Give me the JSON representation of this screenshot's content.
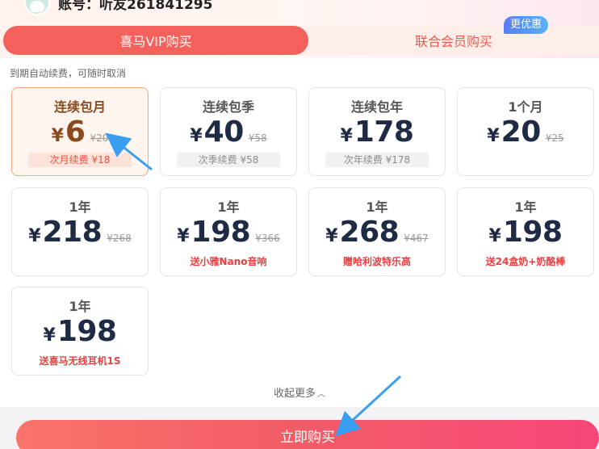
{
  "account": {
    "label": "账号：听友261841295"
  },
  "tabs": [
    {
      "label": "喜马VIP购买"
    },
    {
      "label": "联合会员购买"
    }
  ],
  "badge": "更优惠",
  "hint": "到期自动续费，可随时取消",
  "plans": [
    {
      "title": "连续包月",
      "currency": "¥",
      "price": "6",
      "original": "¥20",
      "note": "次月续费 ¥18"
    },
    {
      "title": "连续包季",
      "currency": "¥",
      "price": "40",
      "original": "¥58",
      "note": "次季续费 ¥58"
    },
    {
      "title": "连续包年",
      "currency": "¥",
      "price": "178",
      "original": "",
      "note": "次年续费 ¥178"
    },
    {
      "title": "1个月",
      "currency": "¥",
      "price": "20",
      "original": "¥25",
      "note": ""
    },
    {
      "title": "1年",
      "currency": "¥",
      "price": "218",
      "original": "¥268",
      "note": ""
    },
    {
      "title": "1年",
      "currency": "¥",
      "price": "198",
      "original": "¥366",
      "note": "送小雅Nano音响"
    },
    {
      "title": "1年",
      "currency": "¥",
      "price": "268",
      "original": "¥467",
      "note": "赠哈利波特乐高"
    },
    {
      "title": "1年",
      "currency": "¥",
      "price": "198",
      "original": "",
      "note": "送24盒奶+奶酪棒"
    },
    {
      "title": "1年",
      "currency": "¥",
      "price": "198",
      "original": "",
      "note": "送喜马无线耳机1S"
    }
  ],
  "collapse": {
    "label": "收起更多",
    "icon": "chevron-up-icon"
  },
  "buy_button": "立即购买",
  "colors": {
    "accent": "#f4615b",
    "price": "#1f2a44",
    "selected_price": "#8a4a1e",
    "gift": "#ea3f3f",
    "annotation_arrow": "#3a9ff0"
  }
}
